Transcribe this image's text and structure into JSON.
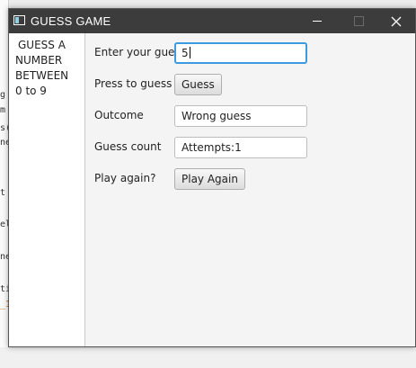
{
  "window": {
    "title": "GUESS GAME"
  },
  "sidebar": {
    "lines": [
      "GUESS A",
      "NUMBER",
      "BETWEEN",
      "0 to 9"
    ]
  },
  "form": {
    "guess": {
      "label": "Enter your guess",
      "value": "5"
    },
    "press": {
      "label": "Press to guess",
      "button": "Guess"
    },
    "outcome": {
      "label": "Outcome",
      "value": "Wrong guess"
    },
    "count": {
      "label": "Guess count",
      "value": "Attempts:1"
    },
    "again": {
      "label": "Play again?",
      "button": "Play Again"
    }
  },
  "background_glimpse": {
    "fragments": [
      "g",
      "m",
      "s(",
      "ne",
      "t",
      "el",
      "ne",
      "ti",
      "_1"
    ]
  },
  "colors": {
    "titlebar": "#3c3c3c",
    "focus_border": "#3d9ade",
    "window_bg": "#f4f4f4"
  }
}
